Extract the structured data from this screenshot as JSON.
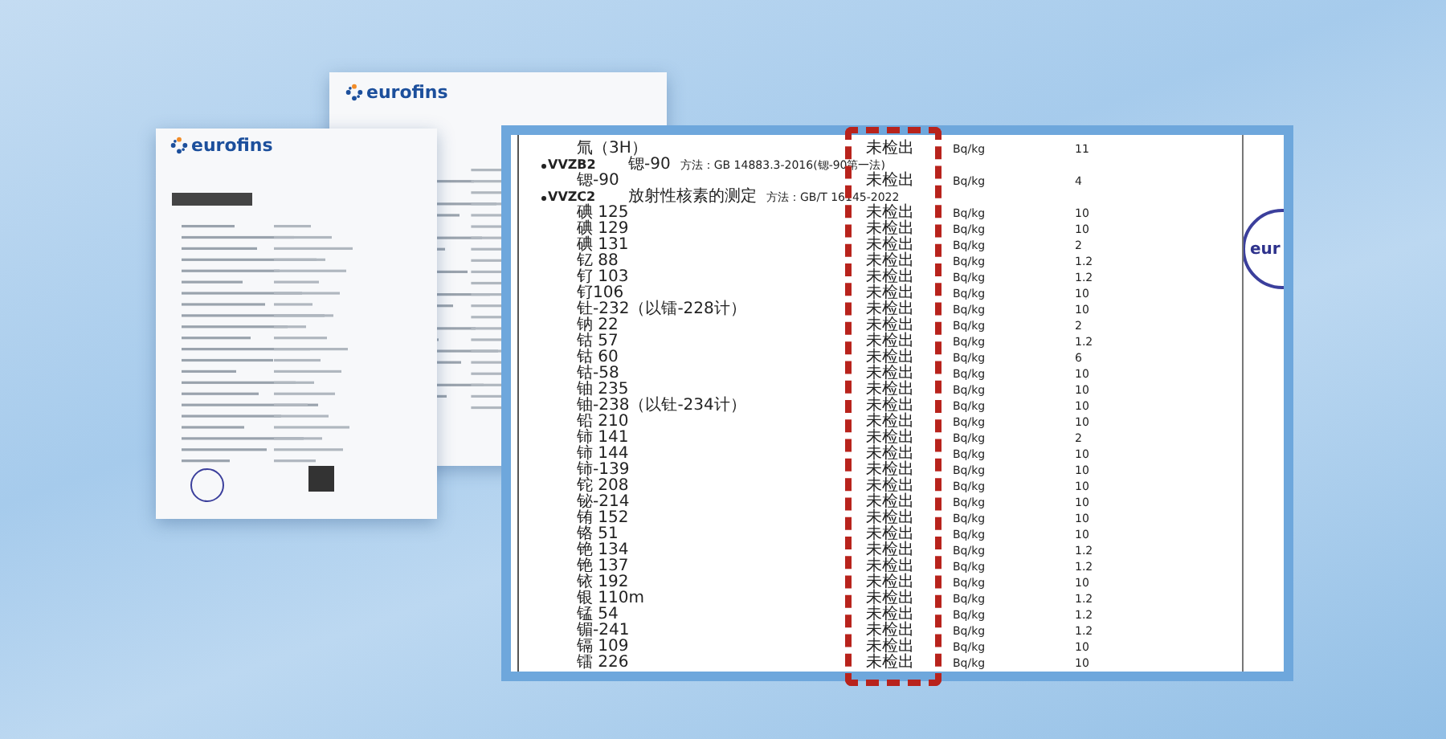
{
  "back_documents": [
    {
      "logo": "eurofins"
    },
    {
      "logo": "eurofins"
    }
  ],
  "stamp": {
    "text": "eur"
  },
  "report": {
    "rows": [
      {
        "kind": "item",
        "name": "氚（3H）",
        "result": "未检出",
        "unit": "Bq/kg",
        "limit": "11"
      },
      {
        "kind": "group",
        "code": "VVZB2",
        "name": "锶-90",
        "method": "方法：GB 14883.3-2016(锶-90第一法)"
      },
      {
        "kind": "item",
        "name": "锶-90",
        "result": "未检出",
        "unit": "Bq/kg",
        "limit": "4"
      },
      {
        "kind": "group",
        "code": "VVZC2",
        "name": "放射性核素的测定",
        "method": "方法：GB/T 16145-2022"
      },
      {
        "kind": "item",
        "name": "碘 125",
        "result": "未检出",
        "unit": "Bq/kg",
        "limit": "10"
      },
      {
        "kind": "item",
        "name": "碘 129",
        "result": "未检出",
        "unit": "Bq/kg",
        "limit": "10"
      },
      {
        "kind": "item",
        "name": "碘 131",
        "result": "未检出",
        "unit": "Bq/kg",
        "limit": "2"
      },
      {
        "kind": "item",
        "name": "钇 88",
        "result": "未检出",
        "unit": "Bq/kg",
        "limit": "1.2"
      },
      {
        "kind": "item",
        "name": "钌 103",
        "result": "未检出",
        "unit": "Bq/kg",
        "limit": "1.2"
      },
      {
        "kind": "item",
        "name": "钌106",
        "result": "未检出",
        "unit": "Bq/kg",
        "limit": "10"
      },
      {
        "kind": "item",
        "name": "钍-232（以镭-228计）",
        "result": "未检出",
        "unit": "Bq/kg",
        "limit": "10"
      },
      {
        "kind": "item",
        "name": "钠 22",
        "result": "未检出",
        "unit": "Bq/kg",
        "limit": "2"
      },
      {
        "kind": "item",
        "name": "钴 57",
        "result": "未检出",
        "unit": "Bq/kg",
        "limit": "1.2"
      },
      {
        "kind": "item",
        "name": "钴 60",
        "result": "未检出",
        "unit": "Bq/kg",
        "limit": "6"
      },
      {
        "kind": "item",
        "name": "钴-58",
        "result": "未检出",
        "unit": "Bq/kg",
        "limit": "10"
      },
      {
        "kind": "item",
        "name": "铀 235",
        "result": "未检出",
        "unit": "Bq/kg",
        "limit": "10"
      },
      {
        "kind": "item",
        "name": "铀-238（以钍-234计）",
        "result": "未检出",
        "unit": "Bq/kg",
        "limit": "10"
      },
      {
        "kind": "item",
        "name": "铅 210",
        "result": "未检出",
        "unit": "Bq/kg",
        "limit": "10"
      },
      {
        "kind": "item",
        "name": "铈 141",
        "result": "未检出",
        "unit": "Bq/kg",
        "limit": "2"
      },
      {
        "kind": "item",
        "name": "铈 144",
        "result": "未检出",
        "unit": "Bq/kg",
        "limit": "10"
      },
      {
        "kind": "item",
        "name": "铈-139",
        "result": "未检出",
        "unit": "Bq/kg",
        "limit": "10"
      },
      {
        "kind": "item",
        "name": "铊 208",
        "result": "未检出",
        "unit": "Bq/kg",
        "limit": "10"
      },
      {
        "kind": "item",
        "name": "铋-214",
        "result": "未检出",
        "unit": "Bq/kg",
        "limit": "10"
      },
      {
        "kind": "item",
        "name": "铕 152",
        "result": "未检出",
        "unit": "Bq/kg",
        "limit": "10"
      },
      {
        "kind": "item",
        "name": "铬 51",
        "result": "未检出",
        "unit": "Bq/kg",
        "limit": "10"
      },
      {
        "kind": "item",
        "name": "铯 134",
        "result": "未检出",
        "unit": "Bq/kg",
        "limit": "1.2"
      },
      {
        "kind": "item",
        "name": "铯 137",
        "result": "未检出",
        "unit": "Bq/kg",
        "limit": "1.2"
      },
      {
        "kind": "item",
        "name": "铱 192",
        "result": "未检出",
        "unit": "Bq/kg",
        "limit": "10"
      },
      {
        "kind": "item",
        "name": "银 110m",
        "result": "未检出",
        "unit": "Bq/kg",
        "limit": "1.2"
      },
      {
        "kind": "item",
        "name": "锰 54",
        "result": "未检出",
        "unit": "Bq/kg",
        "limit": "1.2"
      },
      {
        "kind": "item",
        "name": "镅-241",
        "result": "未检出",
        "unit": "Bq/kg",
        "limit": "1.2"
      },
      {
        "kind": "item",
        "name": "镉 109",
        "result": "未检出",
        "unit": "Bq/kg",
        "limit": "10"
      },
      {
        "kind": "item",
        "name": "镭 226",
        "result": "未检出",
        "unit": "Bq/kg",
        "limit": "10"
      }
    ]
  }
}
